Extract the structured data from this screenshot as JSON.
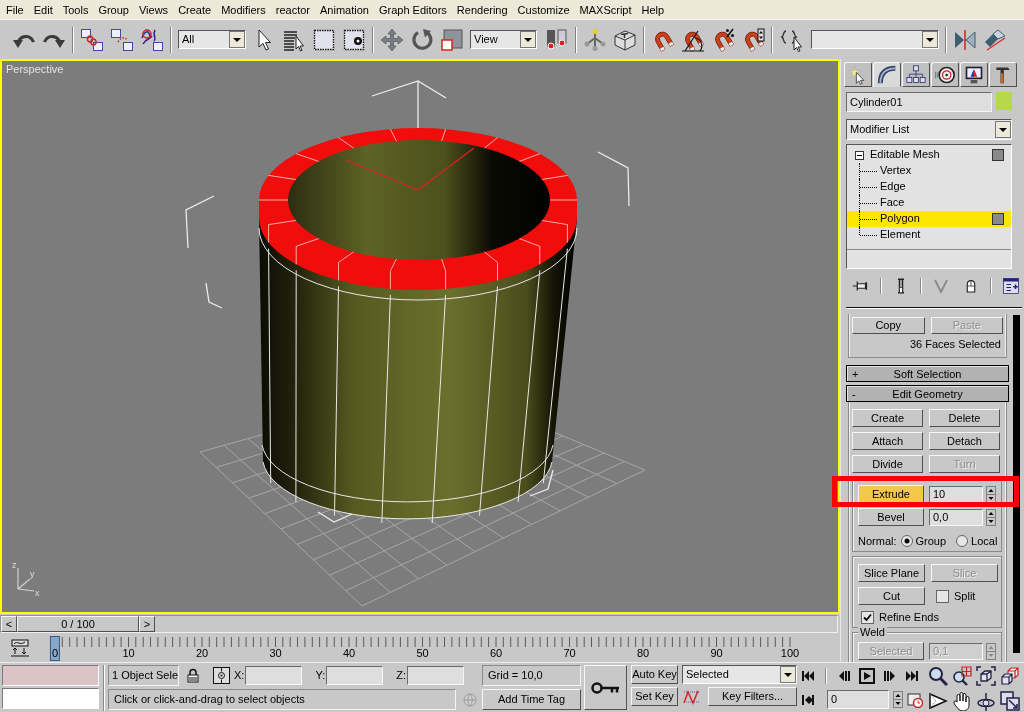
{
  "menu_bar": [
    "File",
    "Edit",
    "Tools",
    "Group",
    "Views",
    "Create",
    "Modifiers",
    "reactor",
    "Animation",
    "Graph Editors",
    "Rendering",
    "Customize",
    "MAXScript",
    "Help"
  ],
  "toolbar": {
    "selection_filter": "All",
    "reference_coordinate_system": "View"
  },
  "viewport": {
    "label": "Perspective",
    "active": true,
    "axis_labels": [
      "z",
      "y",
      "x"
    ]
  },
  "command_panel": {
    "tabs": [
      {
        "kind": "create",
        "selected": false
      },
      {
        "kind": "modify",
        "selected": true
      },
      {
        "kind": "hierarchy",
        "selected": false
      },
      {
        "kind": "motion",
        "selected": false
      },
      {
        "kind": "display",
        "selected": false
      },
      {
        "kind": "utilities",
        "selected": false
      }
    ],
    "object_name": "Cylinder01",
    "modifier_list": "Modifier List",
    "stack": [
      {
        "label": "Editable Mesh",
        "expanded": true,
        "children": [
          {
            "label": "Vertex",
            "selected": false
          },
          {
            "label": "Edge",
            "selected": false
          },
          {
            "label": "Face",
            "selected": false
          },
          {
            "label": "Polygon",
            "selected": true
          },
          {
            "label": "Element",
            "selected": false
          }
        ]
      }
    ],
    "selection": {
      "copy": "Copy",
      "paste": "Paste",
      "paste_disabled": true,
      "info": "36 Faces Selected"
    },
    "rollouts": [
      {
        "sign": "+",
        "title": "Soft Selection"
      },
      {
        "sign": "-",
        "title": "Edit Geometry",
        "groups": [
          {
            "framed": false,
            "rows": [
              {
                "kind": "buttons",
                "buttons": [
                  {
                    "label": "Create",
                    "disabled": false
                  },
                  {
                    "label": "Delete",
                    "disabled": false
                  }
                ]
              },
              {
                "kind": "buttons",
                "buttons": [
                  {
                    "label": "Attach",
                    "disabled": false
                  },
                  {
                    "label": "Detach",
                    "disabled": false
                  }
                ]
              },
              {
                "kind": "buttons",
                "buttons": [
                  {
                    "label": "Divide",
                    "disabled": false
                  },
                  {
                    "label": "Turn",
                    "disabled": true
                  }
                ]
              }
            ]
          },
          {
            "framed": true,
            "rows": [
              {
                "kind": "spinner",
                "label": "Extrude",
                "value": "10",
                "active": true,
                "disabled": false,
                "highlighted": true
              },
              {
                "kind": "spinner",
                "label": "Bevel",
                "value": "0,0",
                "active": false,
                "disabled": false,
                "highlighted": false
              },
              {
                "kind": "radio",
                "label": "Normal:",
                "options": [
                  {
                    "label": "Group",
                    "selected": true
                  },
                  {
                    "label": "Local",
                    "selected": false
                  }
                ]
              }
            ]
          },
          {
            "framed": true,
            "rows": [
              {
                "kind": "buttons",
                "buttons": [
                  {
                    "label": "Slice Plane",
                    "disabled": false
                  },
                  {
                    "label": "Slice",
                    "disabled": true
                  }
                ]
              },
              {
                "kind": "button_check",
                "label": "Cut",
                "check_label": "Split",
                "checked": false
              },
              {
                "kind": "check",
                "label": "Refine Ends",
                "checked": true
              }
            ]
          },
          {
            "framed": true,
            "title": "Weld",
            "rows": [
              {
                "kind": "spinner",
                "label": "Selected",
                "value": "0,1",
                "active": false,
                "disabled": true,
                "highlighted": false
              }
            ]
          }
        ]
      }
    ]
  },
  "time_slider": {
    "previous": "<",
    "position": "0 / 100",
    "next": ">",
    "level": 0
  },
  "track_bar": {
    "frames": [
      {
        "label": "0",
        "selected": true
      },
      {
        "label": "10",
        "selected": false
      },
      {
        "label": "20",
        "selected": false
      },
      {
        "label": "30",
        "selected": false
      },
      {
        "label": "40",
        "selected": false
      },
      {
        "label": "50",
        "selected": false
      },
      {
        "label": "60",
        "selected": false
      },
      {
        "label": "70",
        "selected": false
      },
      {
        "label": "80",
        "selected": false
      },
      {
        "label": "90",
        "selected": false
      },
      {
        "label": "100",
        "selected": false
      }
    ]
  },
  "status_bar": {
    "selection": "1 Object Sele",
    "coordinates": [
      "X:",
      "Y:",
      "Z:"
    ],
    "grid": "Grid = 10,0",
    "prompt": "Click or click-and-drag to select objects",
    "time_tag": "Add Time Tag"
  },
  "animation_controls": {
    "auto_key": {
      "label": "Auto Key",
      "on": false
    },
    "set_key": "Set Key",
    "key_mode": "Selected",
    "key_filters": "Key Filters...",
    "frame": "0"
  }
}
